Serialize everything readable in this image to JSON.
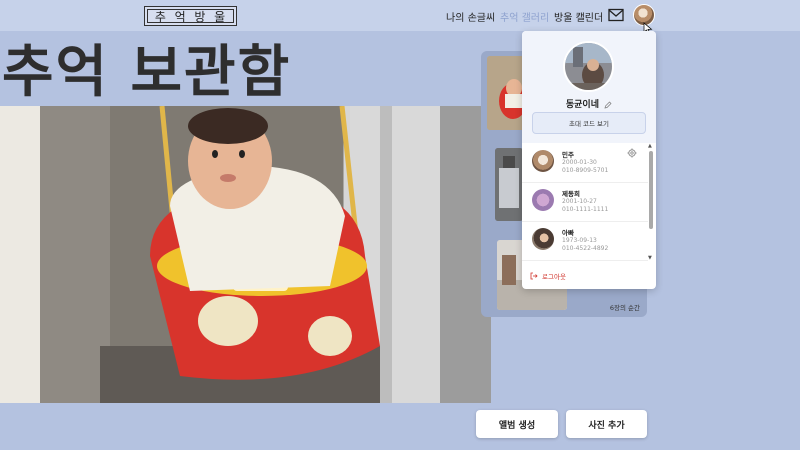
{
  "header": {
    "logo_chars": [
      "추",
      "억",
      "방",
      "울"
    ],
    "nav": [
      "나의 손글씨",
      "추억 갤러리",
      "방울 캘린더"
    ],
    "active_nav": "추억 갤러리"
  },
  "main": {
    "title": "추억 보관함",
    "thumb_caption": "6장의 순간",
    "buttons": {
      "create_album": "앨범 생성",
      "add_photo": "사진 추가"
    }
  },
  "profile_menu": {
    "username": "동균이네",
    "invite_code_label": "초대 코드 보기",
    "members": [
      {
        "name": "민주",
        "birth": "2000-01-30",
        "phone": "010-8909-5701"
      },
      {
        "name": "제동희",
        "birth": "2001-10-27",
        "phone": "010-1111-1111"
      },
      {
        "name": "아빠",
        "birth": "1973-09-13",
        "phone": "010-4522-4892"
      }
    ],
    "logout_label": "로그아웃"
  },
  "colors": {
    "background": "#b4c2e0",
    "header": "#c6d2ea",
    "active_nav": "#8ea2cf",
    "logout": "#d0342c"
  },
  "icons": [
    "mail-icon",
    "edit-icon",
    "gear-icon",
    "logout-icon",
    "scroll-up-icon",
    "scroll-down-icon"
  ]
}
